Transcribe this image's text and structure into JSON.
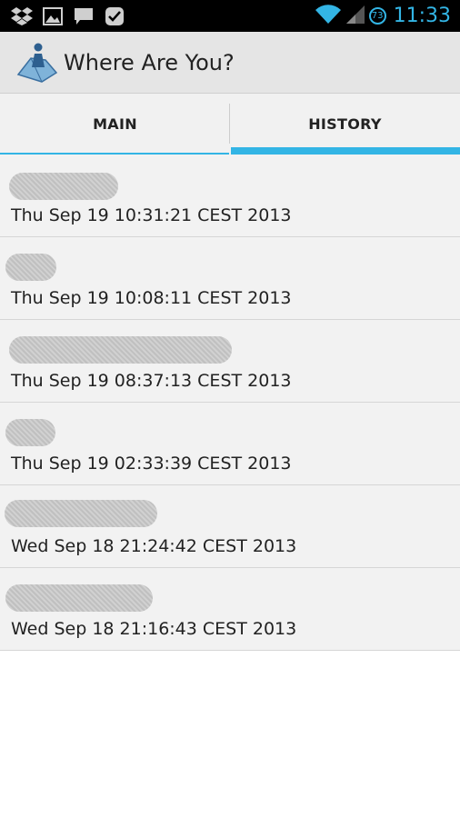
{
  "status_bar": {
    "time": "11:33",
    "battery_level": "73",
    "left_icons": [
      "dropbox-icon",
      "gallery-icon",
      "message-icon",
      "check-badge-icon"
    ],
    "right_icons": [
      "wifi-icon",
      "signal-icon"
    ]
  },
  "action_bar": {
    "title": "Where Are You?",
    "icon": "map-person-icon"
  },
  "tabs": [
    {
      "label": "MAIN",
      "selected": false
    },
    {
      "label": "HISTORY",
      "selected": true
    }
  ],
  "history": [
    {
      "date": "Thu Sep 19 10:31:21 CEST 2013",
      "location_hidden": true
    },
    {
      "date": "Thu Sep 19 10:08:11 CEST 2013",
      "location_hidden": true
    },
    {
      "date": "Thu Sep 19 08:37:13 CEST 2013",
      "location_hidden": true
    },
    {
      "date": "Thu Sep 19 02:33:39 CEST 2013",
      "location_hidden": true
    },
    {
      "date": "Wed Sep 18 21:24:42 CEST 2013",
      "location_hidden": true
    },
    {
      "date": "Wed Sep 18 21:16:43 CEST 2013",
      "location_hidden": true
    }
  ],
  "colors": {
    "accent": "#33b5e5",
    "status_bar": "#000000",
    "action_bar": "#e5e5e5"
  }
}
